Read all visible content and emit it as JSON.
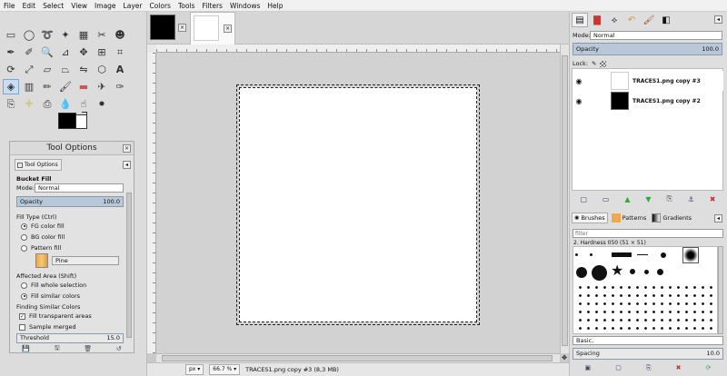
{
  "menu": [
    "File",
    "Edit",
    "Select",
    "View",
    "Image",
    "Layer",
    "Colors",
    "Tools",
    "Filters",
    "Windows",
    "Help"
  ],
  "toolbox": {
    "tools": [
      "rect-select",
      "ellipse-select",
      "free-select",
      "fuzzy-select",
      "by-color-select",
      "scissors-select",
      "foreground-select",
      "paths",
      "color-picker",
      "zoom",
      "measure",
      "move",
      "align",
      "crop",
      "rotate",
      "scale",
      "shear",
      "perspective",
      "flip",
      "cage",
      "text",
      "bucket-fill",
      "blend",
      "pencil",
      "paintbrush",
      "eraser",
      "airbrush",
      "ink",
      "clone",
      "heal",
      "perspective-clone",
      "blur",
      "smudge",
      "dodge"
    ],
    "active_tool": "bucket-fill"
  },
  "tool_options": {
    "panel_title": "Tool Options",
    "tab_label": "Tool Options",
    "tool_name": "Bucket Fill",
    "mode_label": "Mode:",
    "mode_value": "Normal",
    "opacity_label": "Opacity",
    "opacity_value": "100.0",
    "fill_type_label": "Fill Type  (Ctrl)",
    "fill_types": [
      "FG color fill",
      "BG color fill",
      "Pattern fill"
    ],
    "fill_type_selected": 0,
    "pattern_name": "Pine",
    "affected_area_label": "Affected Area  (Shift)",
    "affected_areas": [
      "Fill whole selection",
      "Fill similar colors"
    ],
    "affected_selected": 1,
    "finding_label": "Finding Similar Colors",
    "fill_transparent": "Fill transparent areas",
    "fill_transparent_checked": true,
    "sample_merged": "Sample merged",
    "sample_merged_checked": false,
    "threshold_label": "Threshold",
    "threshold_value": "15.0"
  },
  "image_tab": {
    "close": "×"
  },
  "status": {
    "unit": "px",
    "zoom": "66.7 %",
    "info": "TRACES1.png copy #3 (8,3 MB)"
  },
  "layers": {
    "mode_label": "Mode:",
    "mode_value": "Normal",
    "opacity_label": "Opacity",
    "opacity_value": "100.0",
    "lock_label": "Lock:",
    "items": [
      {
        "name": "TRACES1.png copy #3"
      },
      {
        "name": "TRACES1.png copy #2"
      }
    ]
  },
  "brushes": {
    "tabs": [
      "Brushes",
      "Patterns",
      "Gradients"
    ],
    "filter_placeholder": "filter",
    "selected_brush": "2. Hardness 050 (51 × 51)",
    "preset": "Basic,",
    "spacing_label": "Spacing",
    "spacing_value": "10.0"
  },
  "colors": {
    "accent": "#c9dcf2",
    "slider": "#b8c8d8"
  }
}
